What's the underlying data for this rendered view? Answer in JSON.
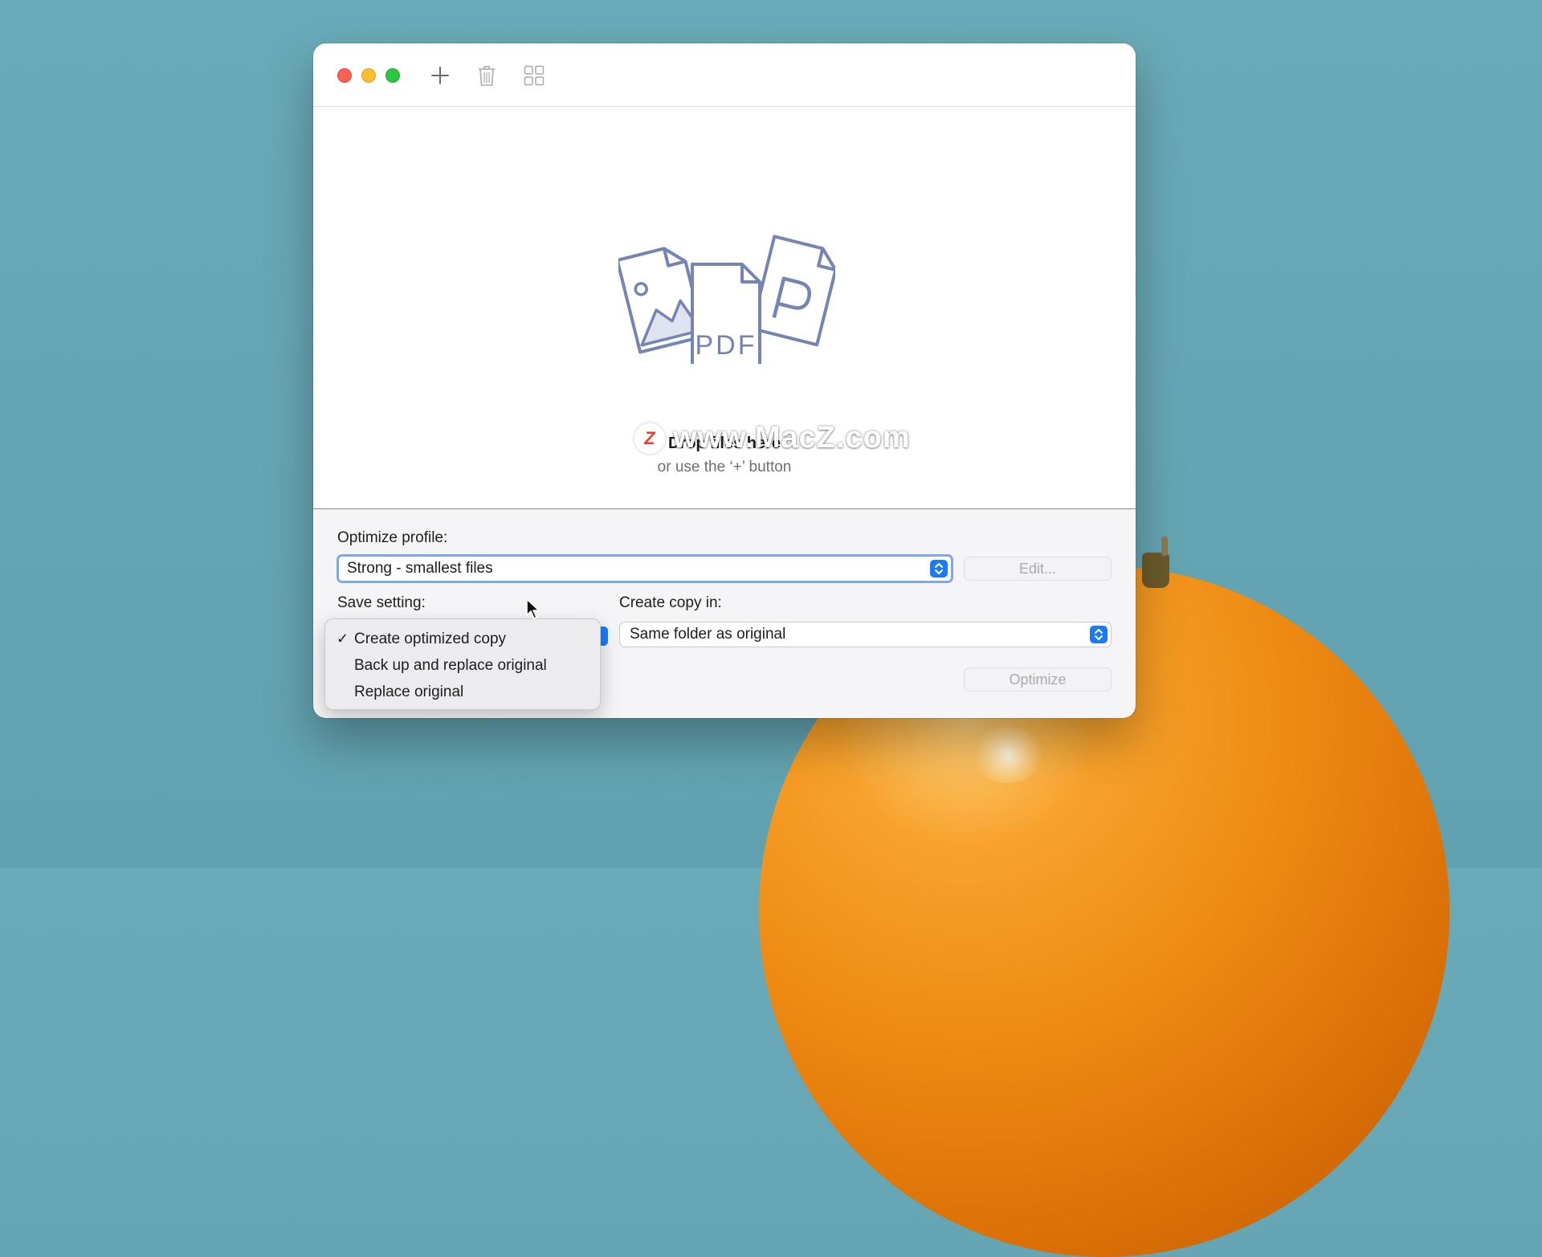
{
  "toolbar": {
    "add_icon": "plus-icon",
    "delete_icon": "trash-icon",
    "grid_icon": "grid-icon"
  },
  "drop_area": {
    "title": "Drop files here",
    "subtitle": "or use the ‘+’ button",
    "pdf_label": "PDF"
  },
  "watermark": {
    "logo_letter": "Z",
    "text": "www.MacZ.com"
  },
  "optimize_profile": {
    "label": "Optimize profile:",
    "value": "Strong - smallest files",
    "edit_label": "Edit..."
  },
  "save_setting": {
    "label": "Save setting:",
    "options": [
      {
        "label": "Create optimized copy",
        "selected": true
      },
      {
        "label": "Back up and replace original",
        "selected": false
      },
      {
        "label": "Replace original",
        "selected": false
      }
    ]
  },
  "create_copy": {
    "label": "Create copy in:",
    "value": "Same folder as original"
  },
  "actions": {
    "optimize_label": "Optimize"
  },
  "colors": {
    "accent": "#1b7bf5",
    "illustration": "#7684b4"
  }
}
